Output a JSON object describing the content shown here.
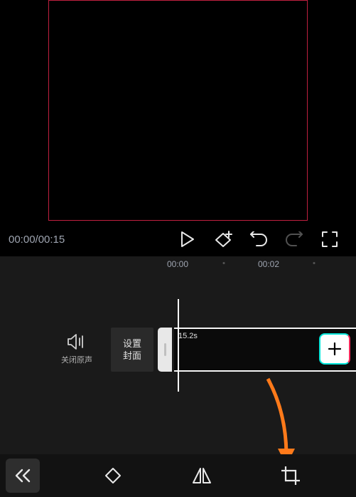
{
  "player": {
    "time_display": "00:00/00:15"
  },
  "timeline": {
    "ruler": {
      "t0": "00:00",
      "t1": "00:02"
    },
    "mute_label": "关闭原声",
    "cover_line1": "设置",
    "cover_line2": "封面",
    "clip_duration": "15.2s"
  },
  "icons": {
    "play": "play-icon",
    "keyframe": "keyframe-add-icon",
    "undo": "undo-icon",
    "redo": "redo-icon",
    "fullscreen": "fullscreen-icon",
    "speaker": "speaker-icon",
    "plus": "plus-icon",
    "back": "double-chevron-left-icon",
    "rotate": "rotate-icon",
    "mirror": "mirror-icon",
    "crop": "crop-icon"
  }
}
